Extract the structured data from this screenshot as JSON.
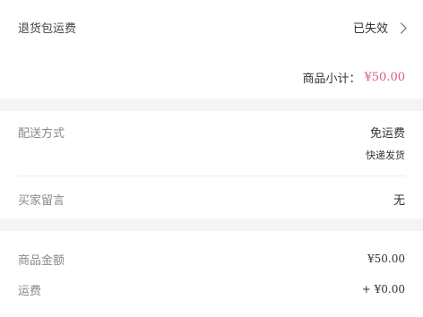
{
  "return_insurance": {
    "label": "退货包运费",
    "status": "已失效"
  },
  "subtotal": {
    "label": "商品小计：",
    "amount": "¥50.00"
  },
  "delivery": {
    "label": "配送方式",
    "value": "免运费",
    "sub": "快递发货"
  },
  "buyer_message": {
    "label": "买家留言",
    "value": "无"
  },
  "summary": {
    "goods_amount_label": "商品金额",
    "goods_amount": "¥50.00",
    "shipping_label": "运费",
    "shipping_amount": "+ ¥0.00"
  },
  "colors": {
    "accent": "#e05a7a",
    "background": "#f4f4f4"
  }
}
